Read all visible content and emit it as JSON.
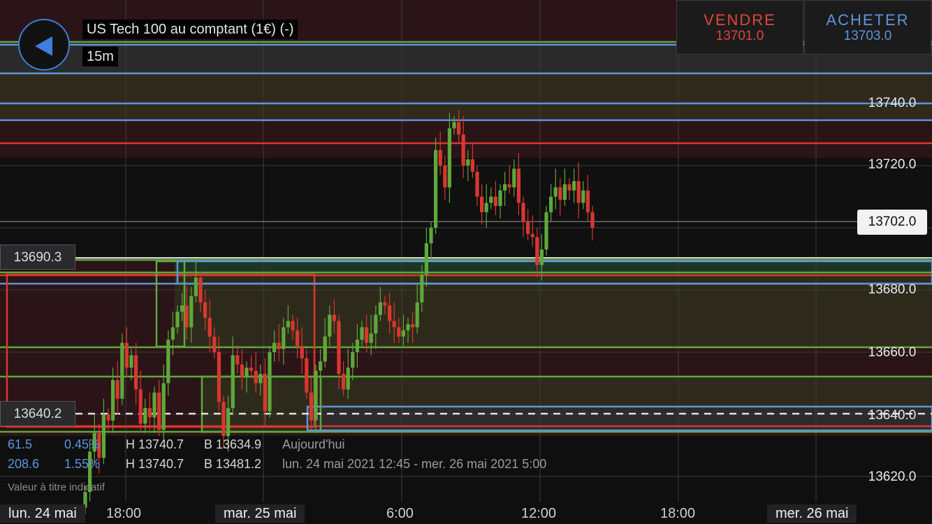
{
  "header": {
    "instrument_title": "US Tech 100 au comptant (1€) (-)",
    "timeframe": "15m",
    "back_icon": "back-arrow-icon"
  },
  "trade": {
    "sell_label": "VENDRE",
    "sell_price": "13701.0",
    "buy_label": "ACHETER",
    "buy_price": "13703.0"
  },
  "stats": {
    "today": {
      "change": "61.5",
      "pct": "0.45%",
      "high": "H 13740.7",
      "low": "B 13634.9",
      "period": "Aujourd'hui"
    },
    "range": {
      "change": "208.6",
      "pct": "1.55%",
      "high": "H 13740.7",
      "low": "B 13481.2",
      "period": "lun. 24 mai 2021 12:45 - mer. 26 mai 2021 5:00"
    }
  },
  "disclaimer": "Valeur à titre indicatif",
  "price_axis": {
    "current": "13702.0",
    "left_upper": "13690.3",
    "left_lower": "13640.2"
  },
  "colors": {
    "sell": "#e0453c",
    "buy": "#5d95da",
    "bull": "#5ea83a",
    "bear": "#d8382f"
  },
  "chart_data": {
    "type": "candlestick",
    "timeframe": "15m",
    "y_ticks": [
      13620,
      13640,
      13660,
      13680,
      13700,
      13720,
      13740
    ],
    "y_tick_labels": [
      "13620.0",
      "13640.0",
      "13660.0",
      "13680.0",
      "13702.0",
      "13720.0",
      "13740.0"
    ],
    "x_labels": [
      "lun. 24 mai",
      "18:00",
      "mar. 25 mai",
      "6:00",
      "12:00",
      "18:00",
      "mer. 26 mai"
    ],
    "current_price": 13702.0,
    "levels": {
      "upper": 13690.3,
      "lower": 13640.2
    },
    "start_close": 13610,
    "closes": [
      13615,
      13628,
      13634,
      13626,
      13640,
      13638,
      13651,
      13645,
      13663,
      13655,
      13659,
      13648,
      13637,
      13642,
      13639,
      13647,
      13635,
      13650,
      13664,
      13668,
      13673,
      13675,
      13668,
      13678,
      13684,
      13676,
      13671,
      13665,
      13660,
      13644,
      13633,
      13642,
      13659,
      13656,
      13652,
      13655,
      13654,
      13650,
      13653,
      13641,
      13660,
      13663,
      13661,
      13668,
      13670,
      13667,
      13662,
      13658,
      13647,
      13638,
      13654,
      13657,
      13665,
      13672,
      13670,
      13653,
      13648,
      13655,
      13660,
      13664,
      13668,
      13663,
      13666,
      13672,
      13676,
      13675,
      13670,
      13668,
      13665,
      13667,
      13669,
      13668,
      13676,
      13685,
      13695,
      13700,
      13725,
      13720,
      13713,
      13732,
      13734,
      13730,
      13720,
      13722,
      13718,
      13710,
      13705,
      13708,
      13710,
      13707,
      13712,
      13714,
      13713,
      13719,
      13708,
      13702,
      13698,
      13697,
      13688,
      13693,
      13705,
      13710,
      13713,
      13709,
      13714,
      13712,
      13715,
      13708,
      13712,
      13705,
      13700
    ]
  }
}
